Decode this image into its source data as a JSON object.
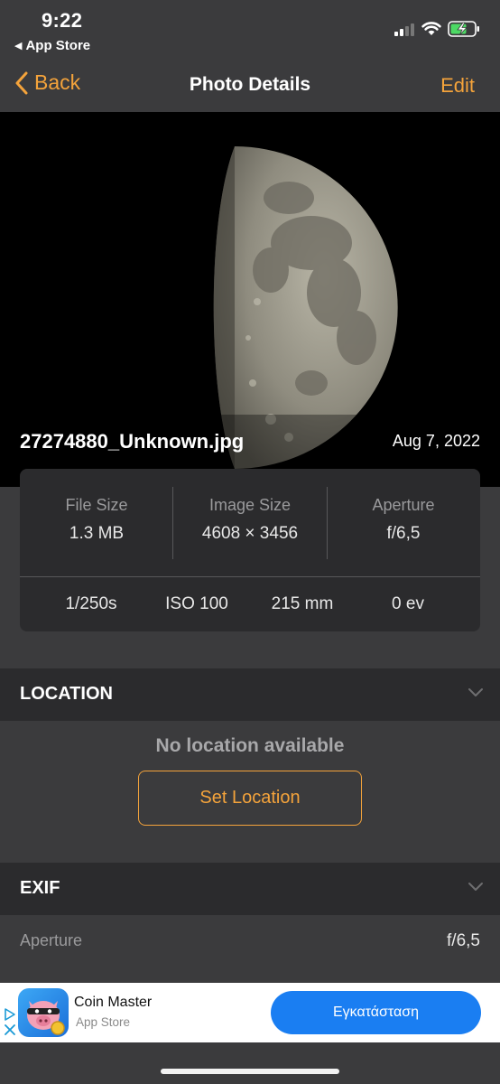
{
  "status": {
    "time": "9:22",
    "back_app": "App Store",
    "signal_bars": 2,
    "battery_charging": true
  },
  "nav": {
    "back_label": "Back",
    "title": "Photo Details",
    "edit_label": "Edit"
  },
  "photo": {
    "filename": "27274880_Unknown.jpg",
    "date": "Aug 7, 2022"
  },
  "info": {
    "file_size_label": "File Size",
    "file_size_value": "1.3 MB",
    "image_size_label": "Image Size",
    "image_size_value": "4608 × 3456",
    "aperture_label": "Aperture",
    "aperture_value": "f/6,5",
    "shutter": "1/250s",
    "iso": "ISO 100",
    "focal": "215 mm",
    "ev": "0 ev"
  },
  "location": {
    "header": "LOCATION",
    "empty_text": "No location available",
    "set_button": "Set Location"
  },
  "exif": {
    "header": "EXIF",
    "rows": [
      {
        "key": "Aperture",
        "value": "f/6,5"
      }
    ]
  },
  "ad": {
    "app_name": "Coin Master",
    "store": "App Store",
    "install_label": "Εγκατάσταση"
  },
  "colors": {
    "accent": "#f4a33b",
    "background": "#3b3b3d",
    "card": "#2b2b2d",
    "install": "#1a7ef2"
  }
}
